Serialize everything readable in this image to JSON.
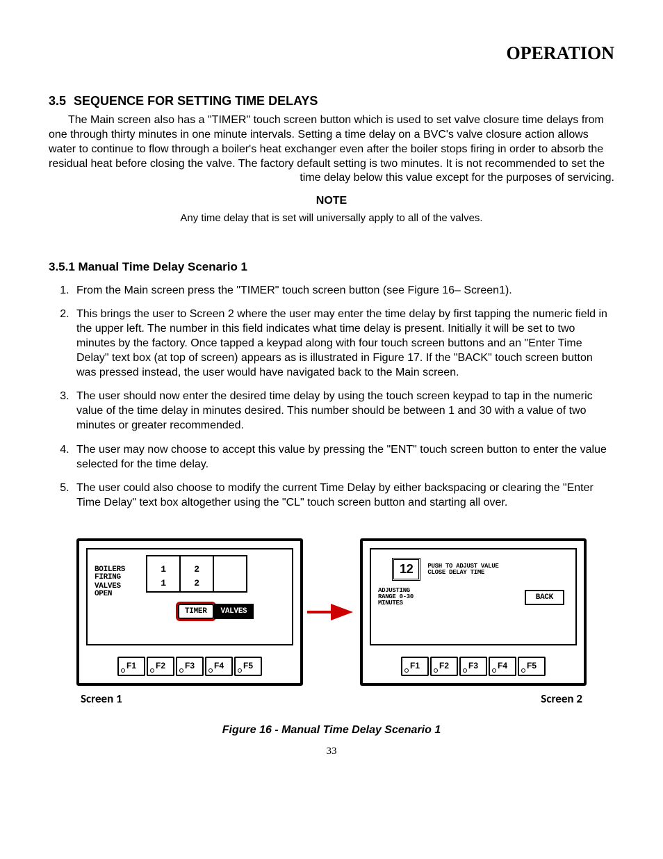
{
  "header": {
    "title": "OPERATION"
  },
  "section": {
    "number": "3.5",
    "title": "SEQUENCE FOR SETTING TIME DELAYS",
    "intro": "The Main screen also has a \"TIMER\" touch screen button which is used to set valve closure time delays from one through thirty minutes in one minute intervals. Setting a time delay on a BVC's valve closure action allows water to continue to flow through a boiler's heat exchanger even after the boiler stops firing in order to absorb the residual heat before closing the valve. The factory default setting is two minutes. It is not recommended to set the time delay below this value except for the purposes of servicing."
  },
  "note": {
    "label": "NOTE",
    "text": "Any time delay that is set will universally apply to all of the valves."
  },
  "subsection": {
    "number": "3.5.1",
    "title": "Manual Time Delay Scenario 1",
    "steps": [
      "From the Main screen press the \"TIMER\" touch screen button (see Figure 16– Screen1).",
      "This brings the user to Screen 2 where the user may enter the time delay by first tapping the numeric field in the upper left. The number in this field indicates what time delay is present. Initially it will be set to two minutes by the factory. Once tapped a keypad along with four touch screen buttons and an \"Enter Time Delay\" text box (at top of screen) appears as is illustrated in Figure 17. If the \"BACK\" touch screen button was pressed instead, the user would have navigated back to the Main screen.",
      "The user should now enter the desired time delay by using the touch screen keypad to tap in the numeric value of the time delay in minutes desired. This number should be between 1 and 30 with a value of two minutes or greater recommended.",
      "The user may now choose to accept this value by pressing the \"ENT\" touch screen button to enter the value selected for the time delay.",
      "The user could also choose to modify the current Time Delay by either backspacing or clearing the \"Enter Time Delay\" text box altogether using the \"CL\" touch screen button and starting all over."
    ]
  },
  "figure": {
    "panel1": {
      "label_boilers": "BOILERS\nFIRING",
      "label_valves": "VALVES\nOPEN",
      "row1": [
        "1",
        "2",
        ""
      ],
      "row2": [
        "1",
        "2",
        ""
      ],
      "timer_btn": "TIMER",
      "valves_btn": "VALVES",
      "caption": "Screen 1"
    },
    "panel2": {
      "value": "12",
      "push_line1": "PUSH TO ADJUST VALUE",
      "push_line2": "CLOSE DELAY TIME",
      "adj_line1": "ADJUSTING",
      "adj_line2": "RANGE 0-30",
      "adj_line3": "MINUTES",
      "back_btn": "BACK",
      "caption": "Screen 2"
    },
    "fkeys": [
      "F1",
      "F2",
      "F3",
      "F4",
      "F5"
    ],
    "caption": "Figure 16 - Manual Time Delay Scenario 1"
  },
  "page_number": "33"
}
